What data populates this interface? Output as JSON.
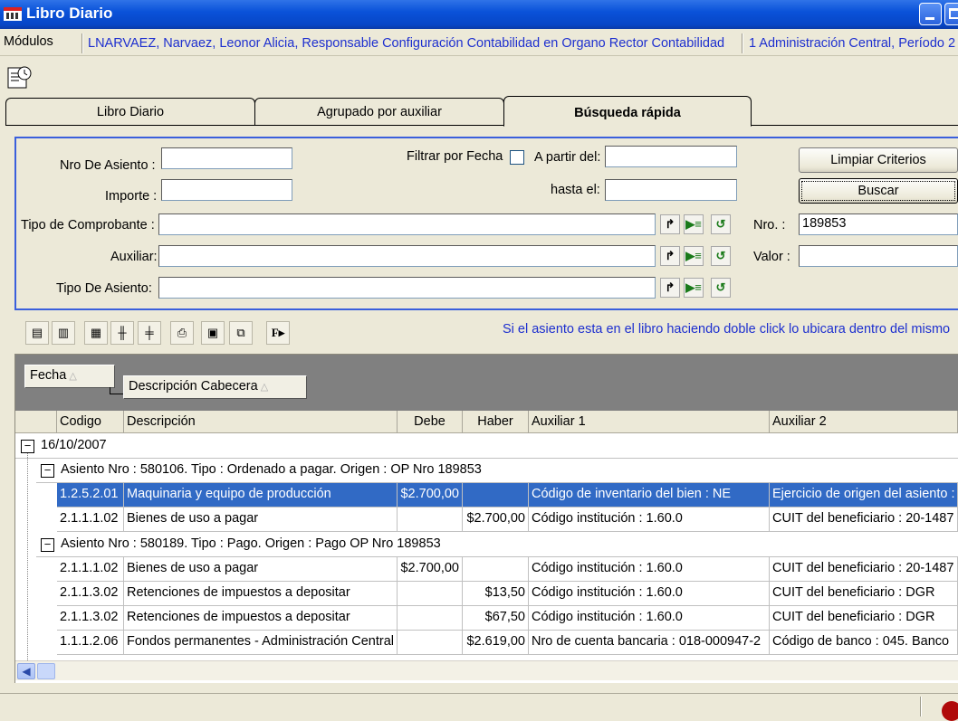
{
  "window": {
    "title": "Libro Diario"
  },
  "infobar": {
    "modules_label": "Módulos",
    "user_info": "LNARVAEZ, Narvaez, Leonor Alicia, Responsable Configuración Contabilidad en Organo Rector Contabilidad",
    "period_info": "1 Administración Central, Período 2"
  },
  "tabs": [
    "Libro Diario",
    "Agrupado por auxiliar",
    "Búsqueda rápida"
  ],
  "criteria": {
    "nro_asiento_label": "Nro De Asiento :",
    "importe_label": "Importe :",
    "tipo_comprobante_label": "Tipo de Comprobante :",
    "auxiliar_label": "Auxiliar:",
    "tipo_asiento_label": "Tipo De Asiento:",
    "filtrar_fecha_label": "Filtrar por Fecha",
    "a_partir_label": "A partir del:",
    "hasta_label": "hasta el:",
    "nro_label": "Nro. :",
    "nro_value": "189853",
    "valor_label": "Valor :",
    "limpiar_button": "Limpiar Criterios",
    "buscar_button": "Buscar"
  },
  "hint": "Si el asiento esta en el libro haciendo doble click lo ubicara dentro del mismo",
  "group_chips": [
    "Fecha",
    "Descripción Cabecera"
  ],
  "columns": [
    "Codigo",
    "Descripción",
    "Debe",
    "Haber",
    "Auxiliar 1",
    "Auxiliar 2"
  ],
  "group_date": "16/10/2007",
  "groups": [
    {
      "header": "Asiento Nro : 580106. Tipo : Ordenado a pagar. Origen : OP Nro 189853",
      "rows": [
        {
          "codigo": "1.2.5.2.01",
          "descripcion": "Maquinaria y equipo de producción",
          "debe": "$2.700,00",
          "haber": "",
          "aux1": "Código de inventario del bien : NE",
          "aux2": "Ejercicio de origen del asiento :"
        },
        {
          "codigo": "2.1.1.1.02",
          "descripcion": "Bienes de uso a pagar",
          "debe": "",
          "haber": "$2.700,00",
          "aux1": "Código institución  : 1.60.0",
          "aux2": "CUIT del beneficiario : 20-1487"
        }
      ]
    },
    {
      "header": "Asiento Nro : 580189. Tipo : Pago. Origen : Pago OP Nro  189853",
      "rows": [
        {
          "codigo": "2.1.1.1.02",
          "descripcion": "Bienes de uso a pagar",
          "debe": "$2.700,00",
          "haber": "",
          "aux1": "Código institución  : 1.60.0",
          "aux2": "CUIT del beneficiario : 20-1487"
        },
        {
          "codigo": "2.1.1.3.02",
          "descripcion": "Retenciones de impuestos a depositar",
          "debe": "",
          "haber": "$13,50",
          "aux1": "Código institución  : 1.60.0",
          "aux2": "CUIT del beneficiario : DGR"
        },
        {
          "codigo": "2.1.1.3.02",
          "descripcion": "Retenciones de impuestos a depositar",
          "debe": "",
          "haber": "$67,50",
          "aux1": "Código institución  : 1.60.0",
          "aux2": "CUIT del beneficiario : DGR"
        },
        {
          "codigo": "1.1.1.2.06",
          "descripcion": "Fondos permanentes - Administración Central",
          "debe": "",
          "haber": "$2.619,00",
          "aux1": "Nro de cuenta bancaria : 018-000947-2",
          "aux2": "Código de banco : 045. Banco"
        }
      ]
    }
  ],
  "colors": {
    "selection": "#316ac5",
    "title_blue": "#0a52d9",
    "hint_blue": "#1d2fcf"
  }
}
